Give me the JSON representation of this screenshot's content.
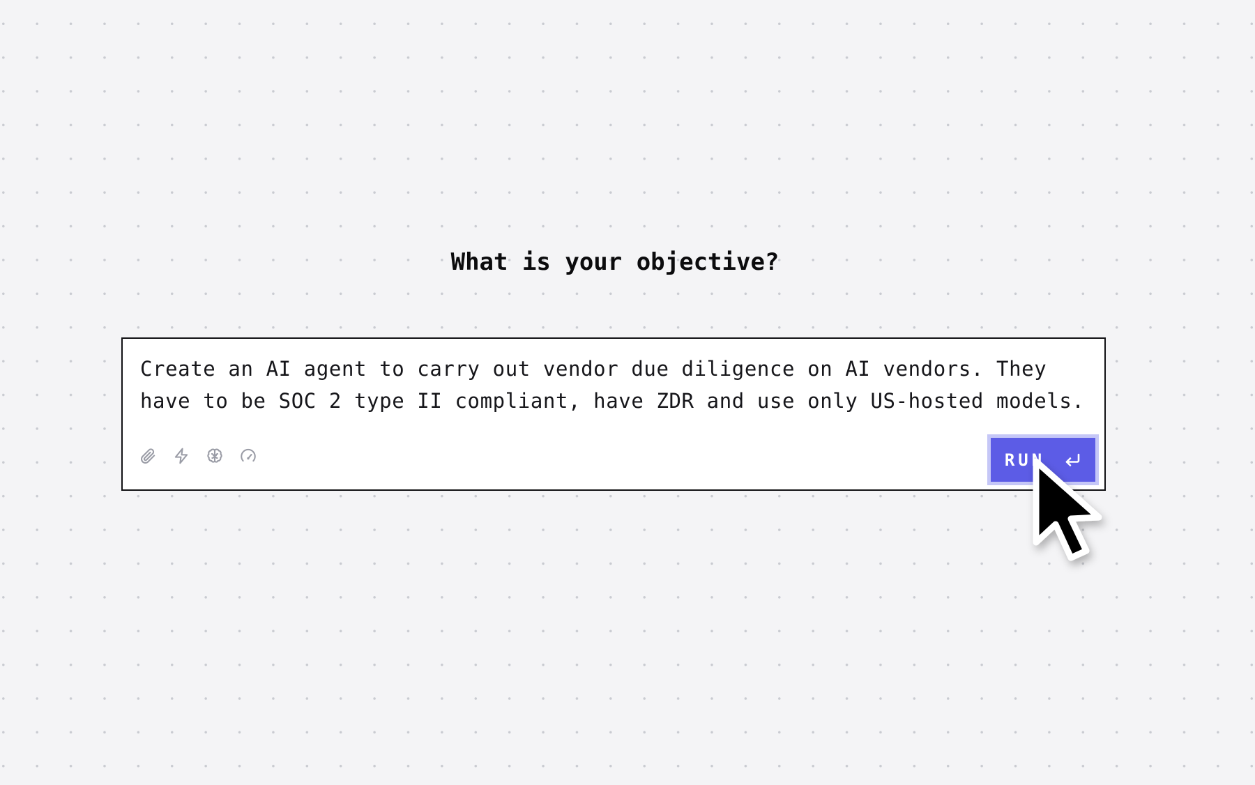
{
  "heading": "What is your objective?",
  "prompt": {
    "value": "Create an AI agent to carry out vendor due diligence on AI vendors. They\nhave to be SOC 2 type II compliant, have ZDR and use only US-hosted models."
  },
  "toolbar": {
    "icons": [
      "paperclip-icon",
      "lightning-icon",
      "brain-icon",
      "gauge-icon"
    ]
  },
  "run_button": {
    "label": "RUN",
    "icon": "enter-icon"
  },
  "colors": {
    "background": "#f4f4f6",
    "accent": "#5c5ce6",
    "accent_border": "#c5c7f7",
    "card_border": "#111114",
    "icon_gray": "#9a9ca6"
  }
}
